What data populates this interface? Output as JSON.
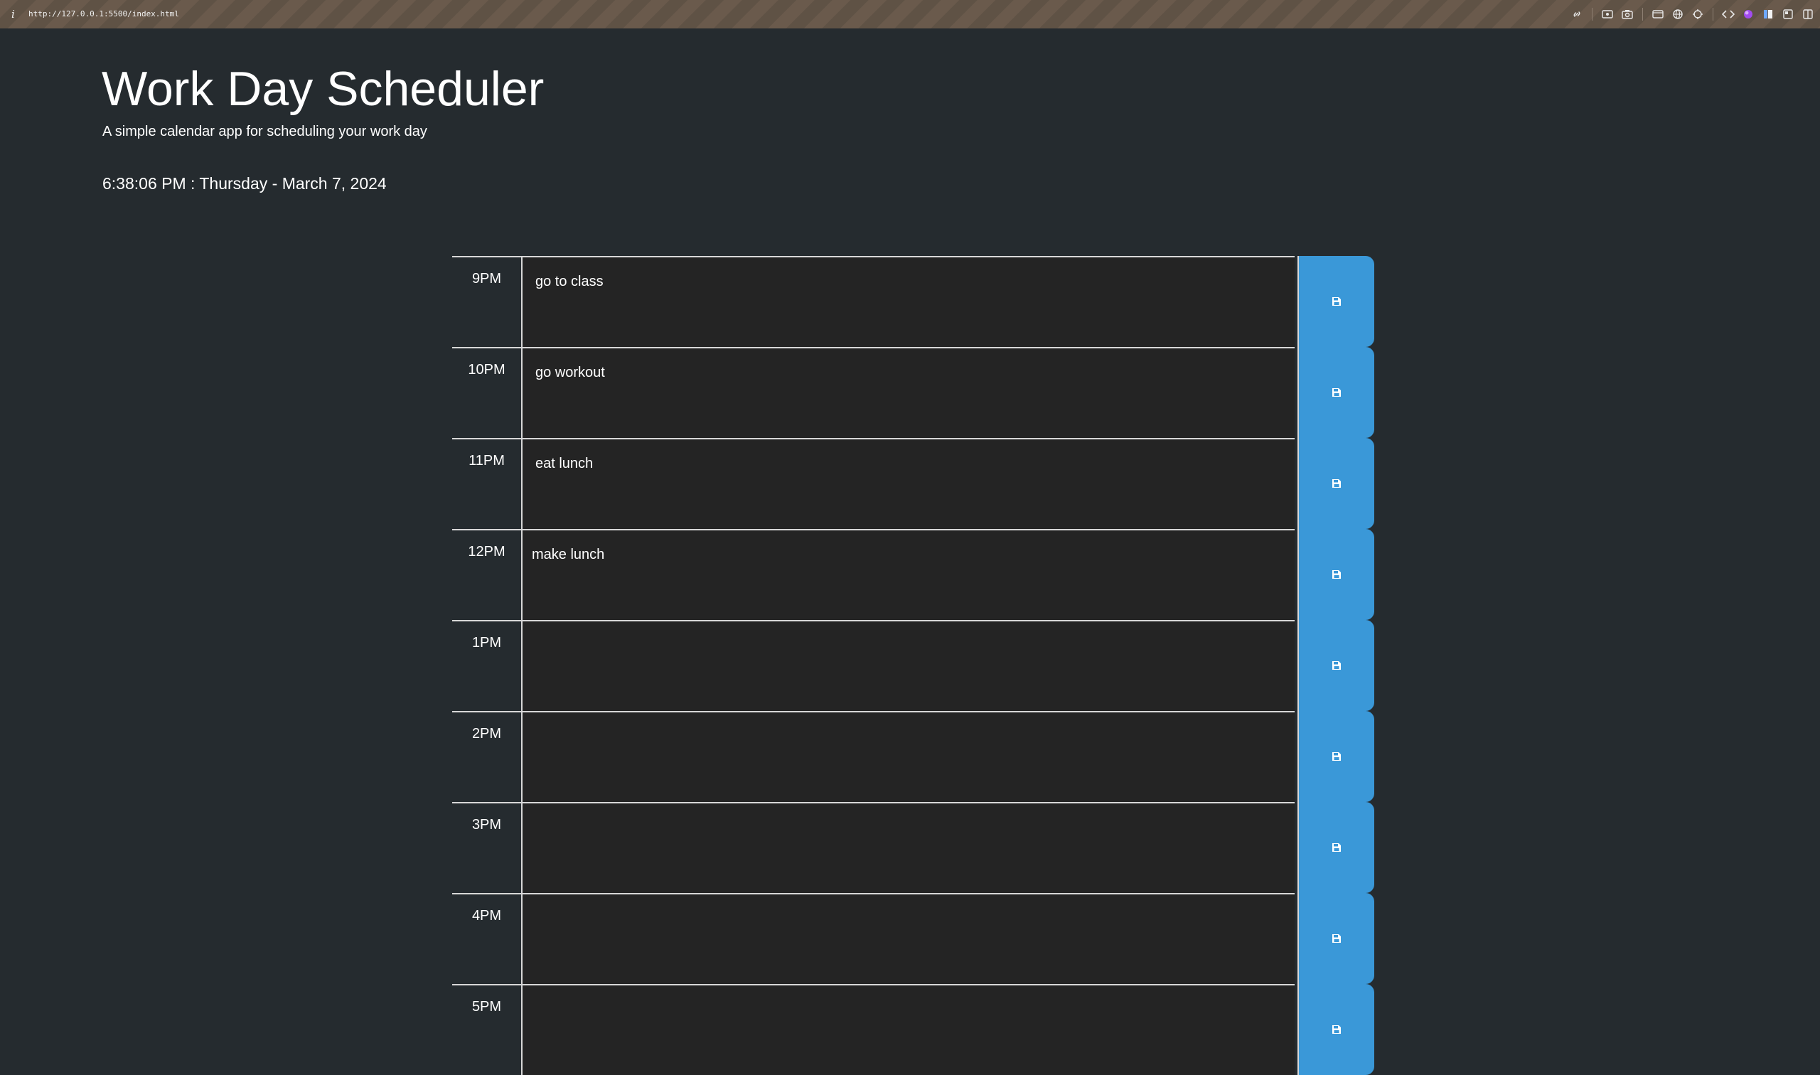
{
  "browser": {
    "info_glyph": "i",
    "url": "http://127.0.0.1:5500/index.html"
  },
  "header": {
    "title": "Work Day Scheduler",
    "subtitle": "A simple calendar app for scheduling your work day",
    "current_datetime": "6:38:06 PM : Thursday - March 7, 2024"
  },
  "rows": [
    {
      "hour": "9PM",
      "text": "go to class"
    },
    {
      "hour": "10PM",
      "text": "go workout"
    },
    {
      "hour": "11PM",
      "text": "eat lunch"
    },
    {
      "hour": "12PM",
      "text": "make lunch"
    },
    {
      "hour": "1PM",
      "text": ""
    },
    {
      "hour": "2PM",
      "text": ""
    },
    {
      "hour": "3PM",
      "text": ""
    },
    {
      "hour": "4PM",
      "text": ""
    },
    {
      "hour": "5PM",
      "text": ""
    }
  ],
  "colors": {
    "background": "#252b2f",
    "textarea": "#242424",
    "save_button": "#3a98d8"
  }
}
